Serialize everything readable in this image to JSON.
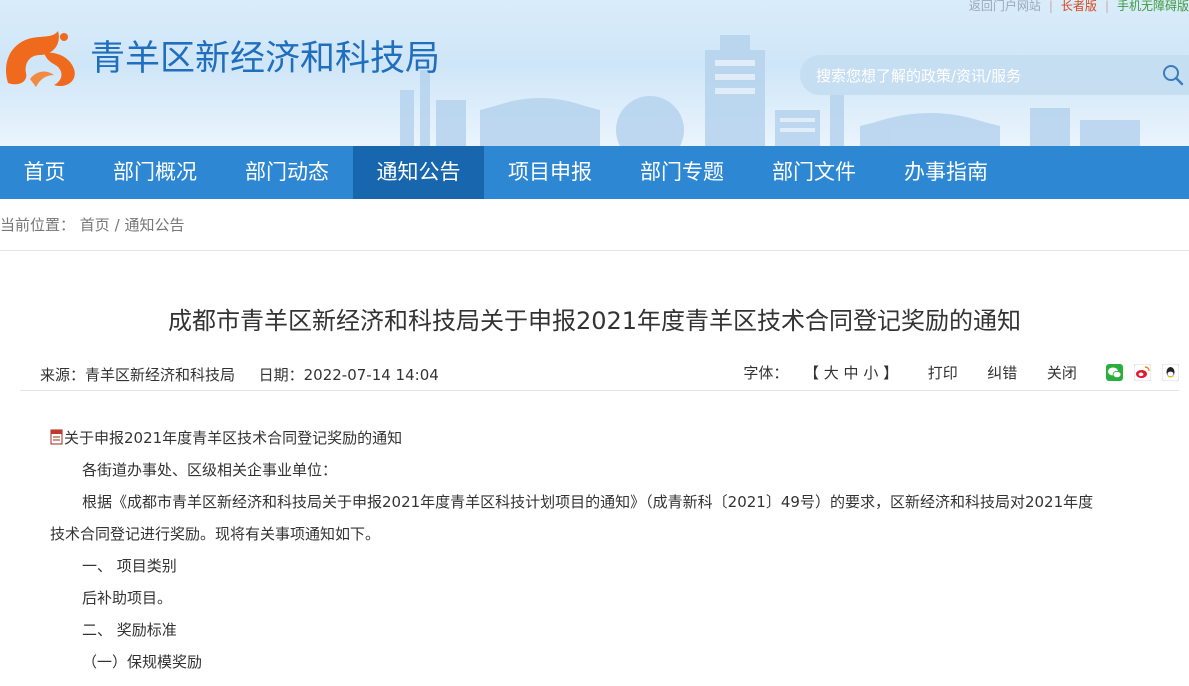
{
  "top_links": {
    "portal": "返回门户网站",
    "elder": "长者版",
    "barrier_free": "手机无障碍版"
  },
  "site": {
    "title": "青羊区新经济和科技局"
  },
  "search": {
    "placeholder": "搜索您想了解的政策/资讯/服务"
  },
  "nav": {
    "items": [
      {
        "label": "首页"
      },
      {
        "label": "部门概况"
      },
      {
        "label": "部门动态"
      },
      {
        "label": "通知公告",
        "active": true
      },
      {
        "label": "项目申报"
      },
      {
        "label": "部门专题"
      },
      {
        "label": "部门文件"
      },
      {
        "label": "办事指南"
      }
    ]
  },
  "breadcrumb": {
    "prefix": "当前位置：",
    "home": "首页",
    "sep": "/",
    "current": "通知公告"
  },
  "article": {
    "title": "成都市青羊区新经济和科技局关于申报2021年度青羊区技术合同登记奖励的通知",
    "source_label": "来源：",
    "source": "青羊区新经济和科技局",
    "date_label": "日期：",
    "date": "2022-07-14 14:04",
    "font_label": "字体：",
    "bracket_open": "【",
    "font_large": "大",
    "font_medium": "中",
    "font_small": "小",
    "bracket_close": "】",
    "print": "打印",
    "correct": "纠错",
    "close": "关闭",
    "attachment": "关于申报2021年度青羊区技术合同登记奖励的通知",
    "paragraphs": {
      "p1": "各街道办事处、区级相关企事业单位：",
      "p2a": "根据《成都市青羊区新经济和科技局关于申报2021年度青羊区科技计划项目的通知》（成青新科〔2021〕49号）的要求，区新经济和科技局对2021年度",
      "p2b": "技术合同登记进行奖励。现将有关事项通知如下。",
      "p3": "一、 项目类别",
      "p4": "后补助项目。",
      "p5": "二、 奖励标准",
      "p6": "（一）保规模奖励"
    }
  },
  "colors": {
    "nav_bg": "#2d87d3",
    "nav_active": "#1766ae",
    "title_blue": "#1f6fbe",
    "logo_orange": "#ef6a1c",
    "elder_red": "#d8461b",
    "barrier_green": "#3f9a3f"
  },
  "icons": [
    "search-icon",
    "logo-icon",
    "file-icon",
    "wechat-icon",
    "weibo-icon",
    "qq-icon"
  ]
}
